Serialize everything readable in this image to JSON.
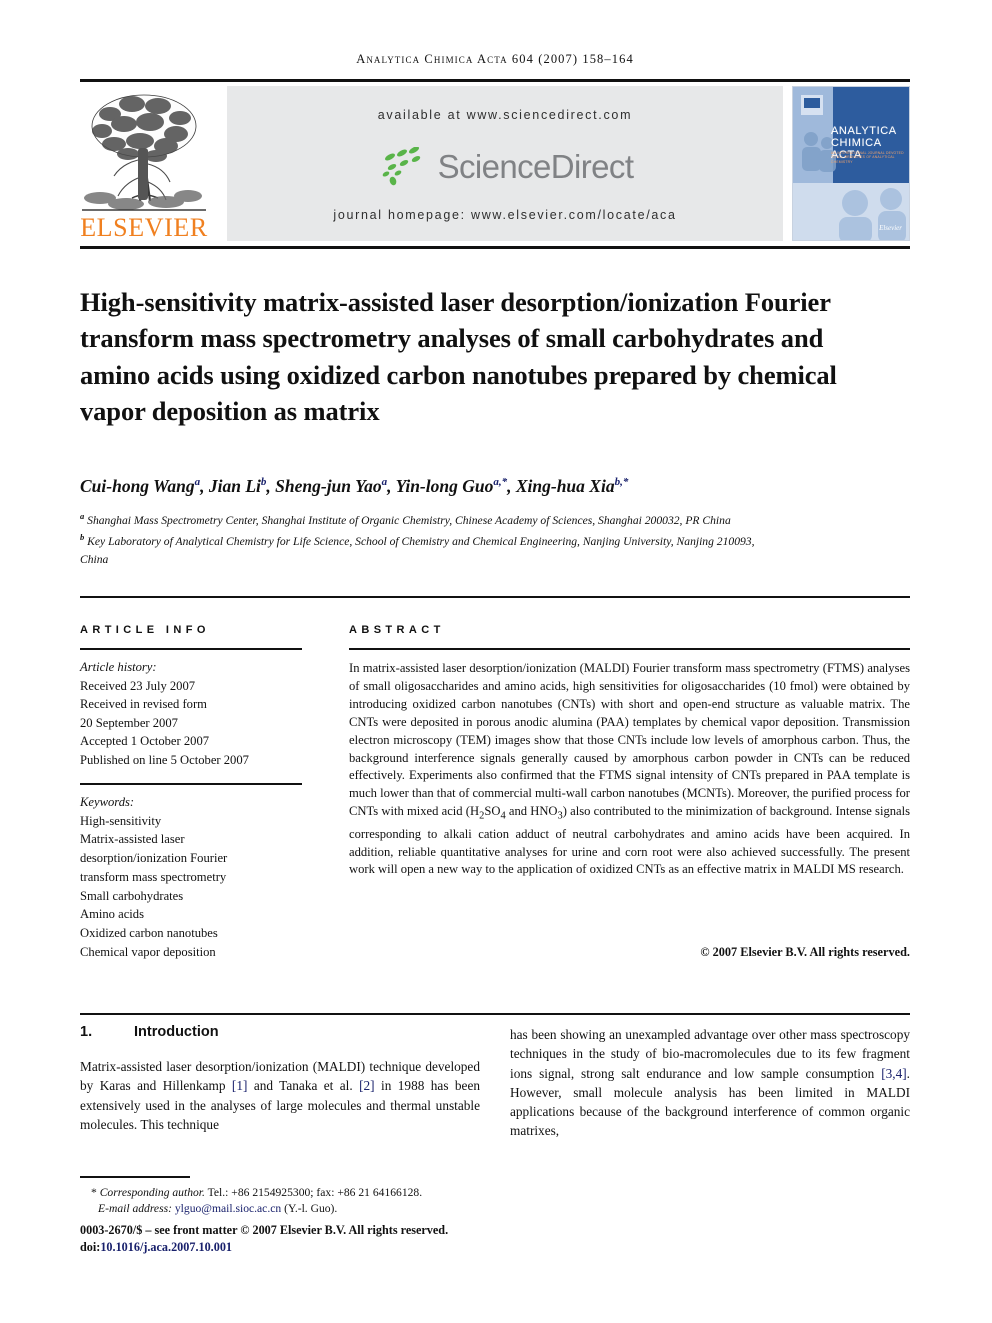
{
  "running_head": "Analytica Chimica Acta 604 (2007) 158–164",
  "masthead": {
    "publisher_name": "ELSEVIER",
    "available_at": "available at www.sciencedirect.com",
    "sciencedirect_wordmark": "ScienceDirect",
    "journal_homepage": "journal homepage: www.elsevier.com/locate/aca",
    "cover": {
      "title_line1": "ANALYTICA",
      "title_line2": "CHIMICA ACTA",
      "subtitle": "AN INTERNATIONAL JOURNAL DEVOTED TO ALL BRANCHES OF ANALYTICAL CHEMISTRY",
      "brand": "Elsevier"
    },
    "colors": {
      "elsevier_orange": "#f08020",
      "banner_grey": "#e7e8e9",
      "sciencedirect_grey": "#808285",
      "sciencedirect_green": "#59b449",
      "cover_blue": "#2d5c9e"
    }
  },
  "title": "High-sensitivity matrix-assisted laser desorption/ionization Fourier transform mass spectrometry analyses of small carbohydrates and amino acids using oxidized carbon nanotubes prepared by chemical vapor deposition as matrix",
  "authors": [
    {
      "name": "Cui-hong Wang",
      "marks": "a"
    },
    {
      "name": "Jian Li",
      "marks": "b"
    },
    {
      "name": "Sheng-jun Yao",
      "marks": "a"
    },
    {
      "name": "Yin-long Guo",
      "marks": "a,*"
    },
    {
      "name": "Xing-hua Xia",
      "marks": "b,*"
    }
  ],
  "affiliations": [
    {
      "mark": "a",
      "text": "Shanghai Mass Spectrometry Center, Shanghai Institute of Organic Chemistry, Chinese Academy of Sciences, Shanghai 200032, PR China"
    },
    {
      "mark": "b",
      "text": "Key Laboratory of Analytical Chemistry for Life Science, School of Chemistry and Chemical Engineering, Nanjing University, Nanjing 210093, China"
    }
  ],
  "article_info": {
    "heading": "ARTICLE INFO",
    "history_label": "Article history:",
    "history": [
      "Received 23 July 2007",
      "Received in revised form",
      "20 September 2007",
      "Accepted 1 October 2007",
      "Published on line 5 October 2007"
    ],
    "keywords_label": "Keywords:",
    "keywords": [
      "High-sensitivity",
      "Matrix-assisted laser",
      "desorption/ionization Fourier",
      "transform mass spectrometry",
      "Small carbohydrates",
      "Amino acids",
      "Oxidized carbon nanotubes",
      "Chemical vapor deposition"
    ]
  },
  "abstract": {
    "heading": "ABSTRACT",
    "text": "In matrix-assisted laser desorption/ionization (MALDI) Fourier transform mass spectrometry (FTMS) analyses of small oligosaccharides and amino acids, high sensitivities for oligosaccharides (10 fmol) were obtained by introducing oxidized carbon nanotubes (CNTs) with short and open-end structure as valuable matrix. The CNTs were deposited in porous anodic alumina (PAA) templates by chemical vapor deposition. Transmission electron microscopy (TEM) images show that those CNTs include low levels of amorphous carbon. Thus, the background interference signals generally caused by amorphous carbon powder in CNTs can be reduced effectively. Experiments also confirmed that the FTMS signal intensity of CNTs prepared in PAA template is much lower than that of commercial multi-wall carbon nanotubes (MCNTs). Moreover, the purified process for CNTs with mixed acid (H2SO4 and HNO3) also contributed to the minimization of background. Intense signals corresponding to alkali cation adduct of neutral carbohydrates and amino acids have been acquired. In addition, reliable quantitative analyses for urine and corn root were also achieved successfully. The present work will open a new way to the application of oxidized CNTs as an effective matrix in MALDI MS research.",
    "copyright": "© 2007 Elsevier B.V. All rights reserved."
  },
  "introduction": {
    "number": "1.",
    "heading": "Introduction",
    "left_text": "Matrix-assisted laser desorption/ionization (MALDI) technique developed by Karas and Hillenkamp [1] and Tanaka et al. [2] in 1988 has been extensively used in the analyses of large molecules and thermal unstable molecules. This technique",
    "right_text": "has been showing an unexampled advantage over other mass spectroscopy techniques in the study of bio-macromolecules due to its few fragment ions signal, strong salt endurance and low sample consumption [3,4]. However, small molecule analysis has been limited in MALDI applications because of the background interference of common organic matrixes,"
  },
  "footnote": {
    "corresponding_marker": "*",
    "corresponding_label": "Corresponding author.",
    "phone_fax": "Tel.: +86 2154925300; fax: +86 21 64166128.",
    "email_label": "E-mail address:",
    "email": "ylguo@mail.sioc.ac.cn",
    "email_owner": "(Y.-l. Guo).",
    "issn_line": "0003-2670/$ – see front matter © 2007 Elsevier B.V. All rights reserved.",
    "doi_label": "doi:",
    "doi": "10.1016/j.aca.2007.10.001"
  }
}
